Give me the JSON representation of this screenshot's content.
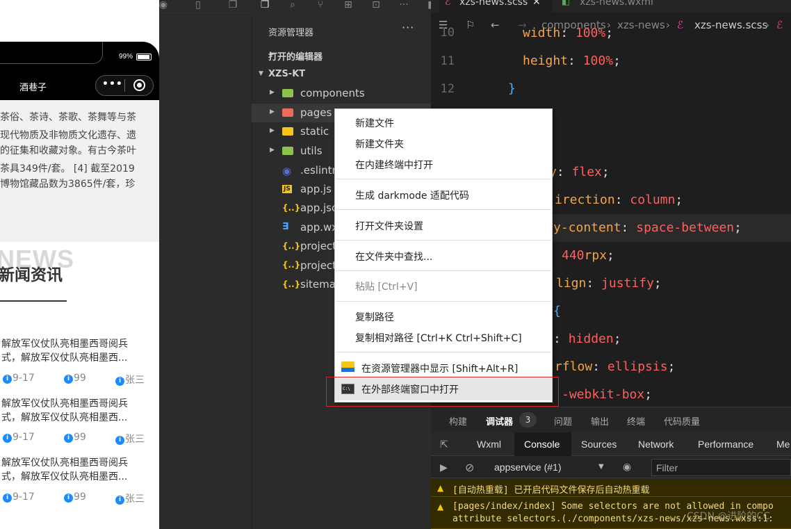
{
  "simulator": {
    "battery_pct": "99%",
    "nav_title": "酒巷子",
    "capsule_dots": "•••",
    "intro_lines": [
      "茶俗、茶诗、茶歌、茶舞等与茶",
      "现代物质及非物质文化遗存、遗",
      "的征集和收藏对象。有古今茶叶",
      "茶具349件/套。 [4] 截至2019",
      "博物馆藏品数为3865件/套，珍"
    ],
    "news_bg_word": "NEWS",
    "news_heading": "新闻资讯",
    "news_items": [
      {
        "line1": "解放军仪仗队亮相墨西哥阅兵",
        "line2": "式，解放军仪仗队亮相墨西...",
        "date": "9-17",
        "views": "99",
        "author": "张三"
      },
      {
        "line1": "解放军仪仗队亮相墨西哥阅兵",
        "line2": "式，解放军仪仗队亮相墨西...",
        "date": "9-17",
        "views": "99",
        "author": "张三"
      },
      {
        "line1": "解放军仪仗队亮相墨西哥阅兵",
        "line2": "式，解放军仪仗队亮相墨西...",
        "date": "9-17",
        "views": "99",
        "author": "张三"
      }
    ]
  },
  "explorer": {
    "title": "资源管理器",
    "more": "···",
    "open_editors": "打开的编辑器",
    "project": "XZS-KT",
    "items": [
      {
        "label": "components",
        "kind": "folder"
      },
      {
        "label": "pages",
        "kind": "folder"
      },
      {
        "label": "static",
        "kind": "folder"
      },
      {
        "label": "utils",
        "kind": "folder"
      },
      {
        "label": ".eslintrc",
        "kind": "file"
      },
      {
        "label": "app.js",
        "kind": "file"
      },
      {
        "label": "app.json",
        "kind": "file"
      },
      {
        "label": "app.wxss",
        "kind": "file"
      },
      {
        "label": "project",
        "kind": "file"
      },
      {
        "label": "project",
        "kind": "file"
      },
      {
        "label": "sitemap",
        "kind": "file"
      }
    ]
  },
  "editor": {
    "tabs": [
      {
        "label": "xzs-news.scss"
      },
      {
        "label": "xzs-news.wxml"
      }
    ],
    "breadcrumb": [
      "components",
      "xzs-news",
      "xzs-news.scss"
    ],
    "line_numbers": [
      "10",
      "11",
      "12"
    ],
    "code": {
      "width_prop": "width",
      "width_val": "100%",
      "height_prop": "height",
      "height_val": "100%",
      "close_brace": "}",
      "display_prop": "y",
      "display_val": "flex",
      "flexdir_prop": "irection",
      "flexdir_val": "column",
      "justify_prop": "y-content",
      "justify_val": "space-between",
      "size_val": "440",
      "size_unit": "rpx",
      "align_prop": "lign",
      "align_val": "justify",
      "open_brace": "{",
      "overflow_val": "hidden",
      "textov_prop": "rflow",
      "textov_val": "ellipsis",
      "box_val": "-webkit-box"
    }
  },
  "context_menu": {
    "items": [
      {
        "label": "新建文件"
      },
      {
        "label": "新建文件夹"
      },
      {
        "label": "在内建终端中打开"
      },
      {
        "label": "生成 darkmode 适配代码"
      },
      {
        "label": "打开文件夹设置"
      },
      {
        "label": "在文件夹中查找..."
      },
      {
        "label": "粘贴  [Ctrl+V]"
      },
      {
        "label": "复制路径"
      },
      {
        "label": "复制相对路径  [Ctrl+K Ctrl+Shift+C]"
      },
      {
        "label": "在资源管理器中显示  [Shift+Alt+R]"
      },
      {
        "label": "在外部终端窗口中打开"
      }
    ]
  },
  "debug_panel": {
    "tabs": [
      "构建",
      "调试器",
      "问题",
      "输出",
      "终端",
      "代码质量"
    ],
    "badge": "3",
    "devtools_tabs": [
      "Wxml",
      "Console",
      "Sources",
      "Network",
      "Performance",
      "Me"
    ],
    "context": "appservice (#1)",
    "filter_placeholder": "Filter",
    "warnings": [
      {
        "text": "[自动热重载] 已开启代码文件保存后自动热重载"
      },
      {
        "text": "[pages/index/index] Some selectors are not allowed in compo",
        "text2": "attribute selectors.(./components/xzs-news/xzs-news.wxss:1:"
      }
    ]
  },
  "watermark": "CSDN @进阶的CC"
}
